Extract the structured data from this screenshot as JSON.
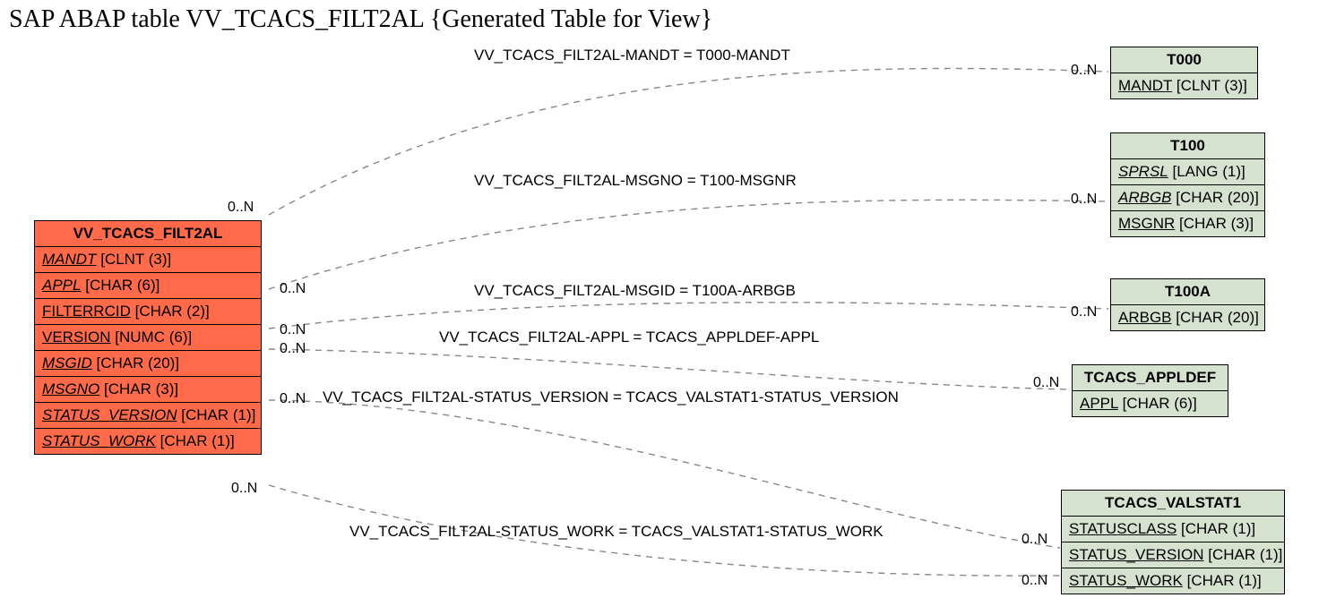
{
  "title": "SAP ABAP table VV_TCACS_FILT2AL {Generated Table for View}",
  "main_entity": {
    "name": "VV_TCACS_FILT2AL",
    "fields": [
      {
        "name": "MANDT",
        "type": "[CLNT (3)]",
        "italic": true
      },
      {
        "name": "APPL",
        "type": "[CHAR (6)]",
        "italic": true
      },
      {
        "name": "FILTERRCID",
        "type": "[CHAR (2)]",
        "italic": false
      },
      {
        "name": "VERSION",
        "type": "[NUMC (6)]",
        "italic": false
      },
      {
        "name": "MSGID",
        "type": "[CHAR (20)]",
        "italic": true
      },
      {
        "name": "MSGNO",
        "type": "[CHAR (3)]",
        "italic": true
      },
      {
        "name": "STATUS_VERSION",
        "type": "[CHAR (1)]",
        "italic": true
      },
      {
        "name": "STATUS_WORK",
        "type": "[CHAR (1)]",
        "italic": true
      }
    ]
  },
  "ref_entities": {
    "t000": {
      "name": "T000",
      "fields": [
        {
          "name": "MANDT",
          "type": "[CLNT (3)]",
          "italic": false
        }
      ]
    },
    "t100": {
      "name": "T100",
      "fields": [
        {
          "name": "SPRSL",
          "type": "[LANG (1)]",
          "italic": true
        },
        {
          "name": "ARBGB",
          "type": "[CHAR (20)]",
          "italic": true
        },
        {
          "name": "MSGNR",
          "type": "[CHAR (3)]",
          "italic": false
        }
      ]
    },
    "t100a": {
      "name": "T100A",
      "fields": [
        {
          "name": "ARBGB",
          "type": "[CHAR (20)]",
          "italic": false
        }
      ]
    },
    "tcacs_appldef": {
      "name": "TCACS_APPLDEF",
      "fields": [
        {
          "name": "APPL",
          "type": "[CHAR (6)]",
          "italic": false
        }
      ]
    },
    "tcacs_valstat1": {
      "name": "TCACS_VALSTAT1",
      "fields": [
        {
          "name": "STATUSCLASS",
          "type": "[CHAR (1)]",
          "italic": false
        },
        {
          "name": "STATUS_VERSION",
          "type": "[CHAR (1)]",
          "italic": false
        },
        {
          "name": "STATUS_WORK",
          "type": "[CHAR (1)]",
          "italic": false
        }
      ]
    }
  },
  "relations": {
    "r1": "VV_TCACS_FILT2AL-MANDT = T000-MANDT",
    "r2": "VV_TCACS_FILT2AL-MSGNO = T100-MSGNR",
    "r3": "VV_TCACS_FILT2AL-MSGID = T100A-ARBGB",
    "r4": "VV_TCACS_FILT2AL-APPL = TCACS_APPLDEF-APPL",
    "r5": "VV_TCACS_FILT2AL-STATUS_VERSION = TCACS_VALSTAT1-STATUS_VERSION",
    "r6": "VV_TCACS_FILT2AL-STATUS_WORK = TCACS_VALSTAT1-STATUS_WORK"
  },
  "cardinality": "0..N"
}
